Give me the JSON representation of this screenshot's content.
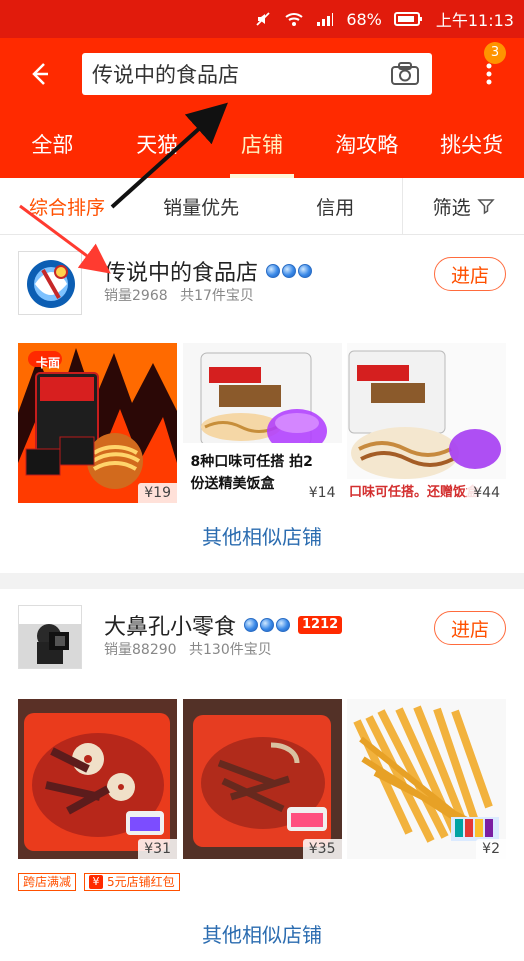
{
  "status_bar": {
    "battery": "68%",
    "time": "上午11:13"
  },
  "header": {
    "search_text": "传说中的食品店",
    "badge_count": "3"
  },
  "tabs": [
    {
      "label": "全部"
    },
    {
      "label": "天猫"
    },
    {
      "label": "店铺"
    },
    {
      "label": "淘攻略"
    },
    {
      "label": "挑尖货"
    }
  ],
  "sort": [
    {
      "label": "综合排序"
    },
    {
      "label": "销量优先"
    },
    {
      "label": "信用"
    },
    {
      "label": "筛选"
    }
  ],
  "shops": [
    {
      "name": "传说中的食品店",
      "sales_label": "销量2968",
      "items_label": "共17件宝贝",
      "enter_label": "进店",
      "products": [
        {
          "price": "¥19",
          "image_text": "卡面"
        },
        {
          "price": "¥14",
          "image_text": "8种口味可任搭 拍2份送精美饭盒"
        },
        {
          "price": "¥44",
          "image_text": "口味可任搭。还赠饭盒"
        }
      ],
      "similar_label": "其他相似店铺"
    },
    {
      "name": "大鼻孔小零食",
      "badge": "1212",
      "sales_label": "销量88290",
      "items_label": "共130件宝贝",
      "enter_label": "进店",
      "products": [
        {
          "price": "¥31"
        },
        {
          "price": "¥35"
        },
        {
          "price": "¥2"
        }
      ],
      "coupons": [
        {
          "label": "跨店满减"
        },
        {
          "label": "5元店铺红包",
          "icon": "¥"
        }
      ],
      "similar_label": "其他相似店铺"
    }
  ],
  "colors": {
    "header_red": "#ff2a00",
    "status_red": "#e11b0c",
    "accent_orange": "#ff5000",
    "link_blue": "#2b6cb0"
  }
}
